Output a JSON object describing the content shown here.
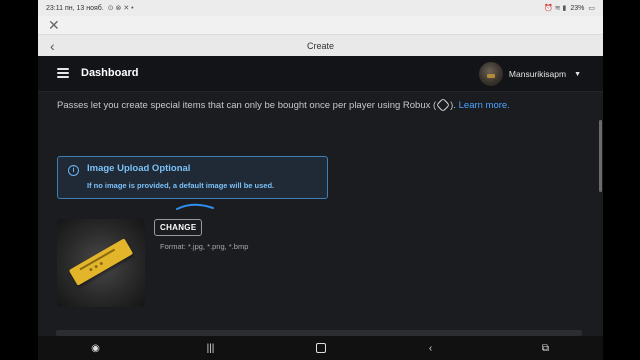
{
  "status_bar": {
    "time_date": "23:11 пн, 13 нояб.",
    "battery": "23%"
  },
  "browser": {
    "title": "Create",
    "close_icon": "close-icon",
    "back_icon": "chevron-left-icon"
  },
  "header": {
    "title": "Dashboard",
    "username": "Mansurikisapm"
  },
  "content": {
    "description_prefix": "Passes let you create special items that can only be bought once per player using Robux (",
    "description_suffix": ").",
    "learn_more": "Learn more.",
    "notice": {
      "title": "Image Upload Optional",
      "body": "If no image is provided, a default image will be used."
    },
    "change_label": "CHANGE",
    "format_text": "Format: *.jpg, *.png, *.bmp"
  },
  "colors": {
    "accent": "#4aa3ff",
    "notice_border": "#3d7fb8",
    "pass_gold": "#e3b52a"
  }
}
